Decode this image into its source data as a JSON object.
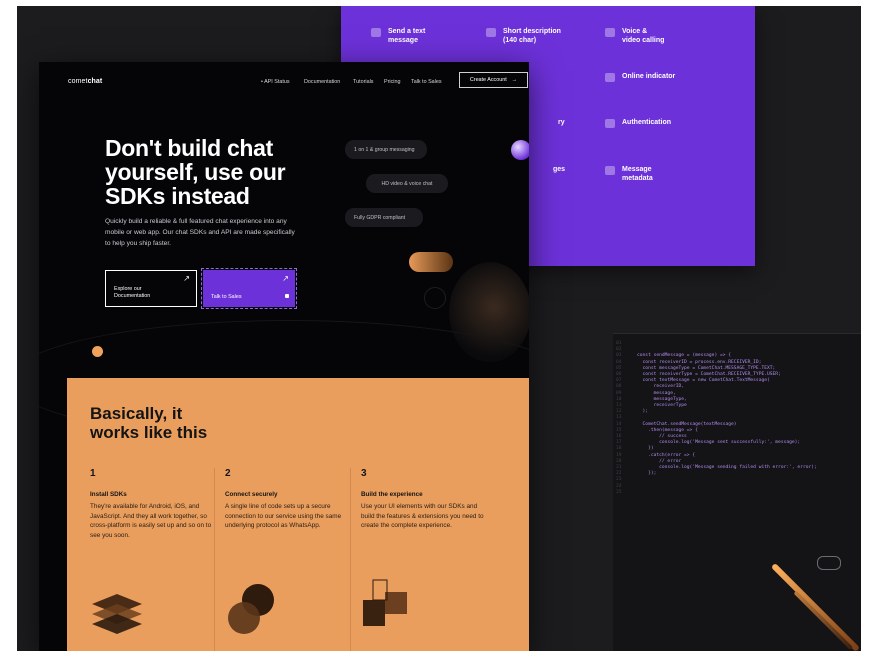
{
  "features": [
    {
      "label": "Send a text message",
      "line1": "Send a text",
      "line2": "message"
    },
    {
      "label": "Short description (140 char)",
      "line1": "Short description",
      "line2": "(140 char)"
    },
    {
      "label": "Voice & video calling",
      "line1": "Voice &",
      "line2": "video calling"
    },
    {
      "label": "Online indicator",
      "line1": "Online indicator",
      "line2": ""
    },
    {
      "label": "Authentication",
      "line1": "Authentication",
      "line2": ""
    },
    {
      "label": "Message metadata",
      "line1": "Message",
      "line2": "metadata"
    }
  ],
  "partial": {
    "ry": "ry",
    "ges": "ges"
  },
  "code": {
    "line_numbers": "01\n02\n03\n04\n05\n06\n07\n08\n09\n10\n11\n12\n13\n14\n15\n16\n17\n18\n19\n20\n21\n22\n23\n24\n25",
    "text": "\n\nconst sendMessage = (message) => {\n  const receiverID = process.env.RECEIVER_ID;\n  const messageType = CometChat.MESSAGE_TYPE.TEXT;\n  const receiverType = CometChat.RECEIVER_TYPE.USER;\n  const textMessage = new CometChat.TextMessage(\n      receiverID,\n      message,\n      messageType,\n      receiverType\n  );\n\n  CometChat.sendMessage(textMessage)\n    .then(message => {\n        // success\n        console.log('Message sent successfully:', message);\n    })\n    .catch(error => {\n        // error\n        console.log('Message sending failed with error:', error);\n    });"
  },
  "header": {
    "logo_light": "comet",
    "logo_bold": "chat",
    "nav": [
      "• API Status",
      "Documentation",
      "Tutorials",
      "Pricing",
      "Talk to Sales"
    ],
    "cta": "Create Account",
    "cta_arrow": "→"
  },
  "hero": {
    "title": "Don't build chat yourself, use our SDKs instead",
    "subtitle": "Quickly build a reliable & full featured chat experience into any mobile or web app. Our chat SDKs and API are made specifically to help you ship faster.",
    "button_primary_line1": "Explore our",
    "button_primary_line2": "Documentation",
    "button_secondary": "Talk to Sales",
    "arrow": "↗"
  },
  "bubbles": [
    "1 on 1 & group messaging",
    "HD video & voice chat",
    "Fully GDPR compliant"
  ],
  "how": {
    "title_line1": "Basically, it",
    "title_line2": "works like this",
    "steps": [
      {
        "num": "1",
        "title": "Install SDKs",
        "desc": "They're available for Android, iOS, and JavaScript. And they all work together, so cross-platform is easily set up and so on to see you soon."
      },
      {
        "num": "2",
        "title": "Connect securely",
        "desc": "A single line of code sets up a secure connection to our service using the same underlying protocol as WhatsApp."
      },
      {
        "num": "3",
        "title": "Build the experience",
        "desc": "Use your UI elements with our SDKs and build the features & extensions you need to create the complete experience."
      }
    ]
  },
  "colors": {
    "purple": "#6d31d9",
    "orange": "#ea9e5d",
    "dark": "#050507"
  }
}
